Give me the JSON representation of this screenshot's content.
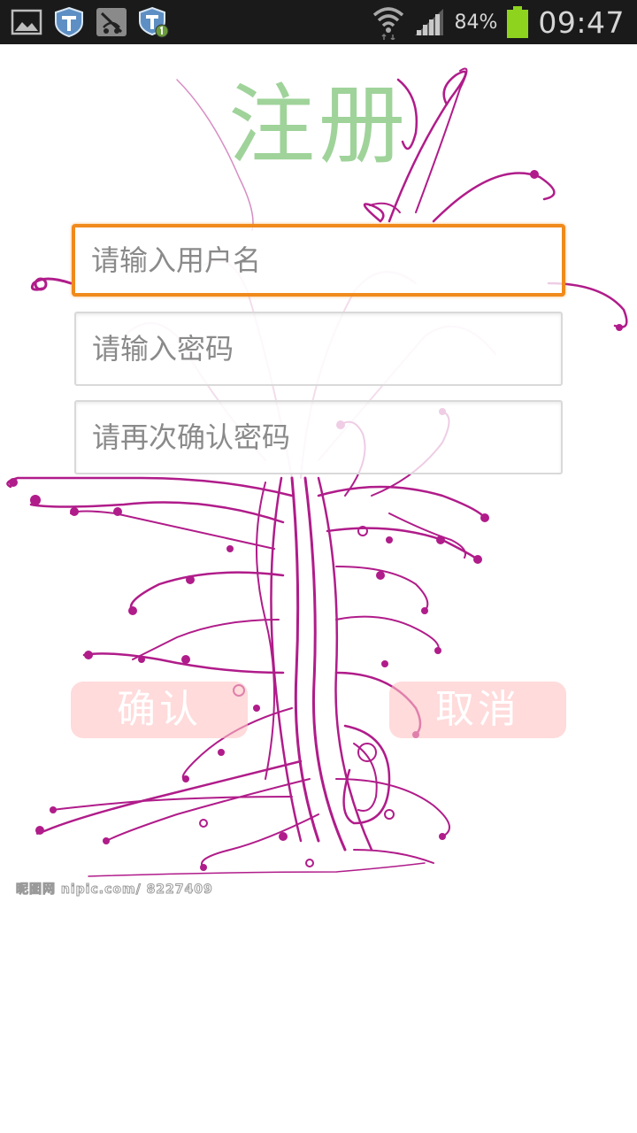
{
  "status_bar": {
    "notification_icons": [
      "gallery-icon",
      "shield-t-icon",
      "no-signal-app-icon",
      "shield-t-update-icon"
    ],
    "battery_percent": "84%",
    "time": "09:47",
    "battery_color": "#8ed41f"
  },
  "title": "注册",
  "form": {
    "username_placeholder": "请输入用户名",
    "password_placeholder": "请输入密码",
    "confirm_placeholder": "请再次确认密码"
  },
  "buttons": {
    "confirm": "确认",
    "cancel": "取消"
  },
  "watermark": "昵图网 nipic.com/ 8227409",
  "colors": {
    "title": "#9fd39a",
    "focus_border": "#f08a1c",
    "button_bg": "#ffc3c3",
    "floral": "#b01c8a"
  }
}
